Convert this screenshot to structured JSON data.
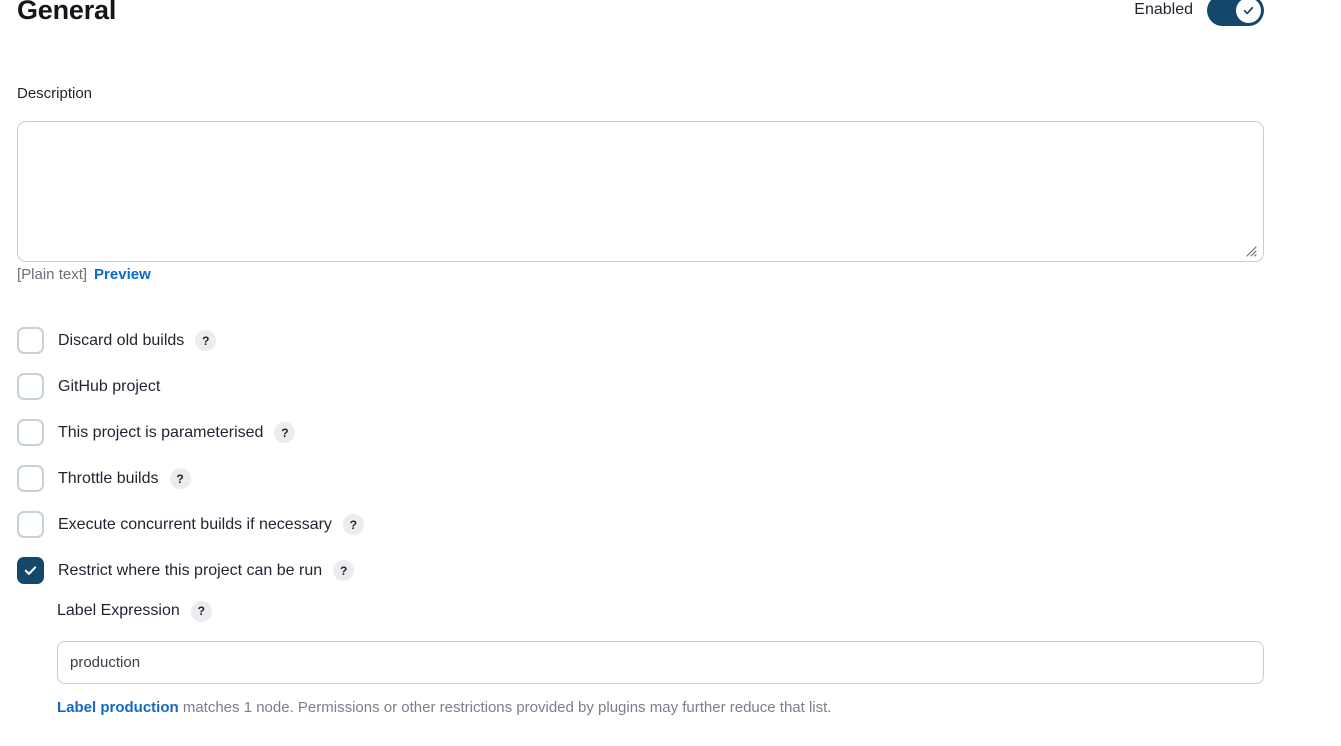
{
  "header": {
    "title": "General",
    "enabled_label": "Enabled",
    "toggle_state": "on",
    "toggle_icon": "check-icon",
    "toggle_color": "#14486b"
  },
  "description": {
    "label": "Description",
    "value": "",
    "placeholder": "",
    "format_note": "[Plain text]",
    "preview_link": "Preview"
  },
  "options": [
    {
      "label": "Discard old builds",
      "checked": false,
      "has_help": true,
      "help_glyph": "?"
    },
    {
      "label": "GitHub project",
      "checked": false,
      "has_help": false,
      "help_glyph": "?"
    },
    {
      "label": "This project is parameterised",
      "checked": false,
      "has_help": true,
      "help_glyph": "?"
    },
    {
      "label": "Throttle builds",
      "checked": false,
      "has_help": true,
      "help_glyph": "?"
    },
    {
      "label": "Execute concurrent builds if necessary",
      "checked": false,
      "has_help": true,
      "help_glyph": "?"
    },
    {
      "label": "Restrict where this project can be run",
      "checked": true,
      "has_help": true,
      "help_glyph": "?"
    }
  ],
  "label_expression": {
    "title": "Label Expression",
    "help_glyph": "?",
    "value": "production",
    "placeholder": "",
    "hint_link": "Label production",
    "hint_text": " matches 1 node. Permissions or other restrictions provided by plugins may further reduce that list."
  },
  "colors": {
    "accent": "#14486b",
    "link": "#0b6aca",
    "border": "#c3ced6",
    "muted_text": "#7a7f8c"
  }
}
